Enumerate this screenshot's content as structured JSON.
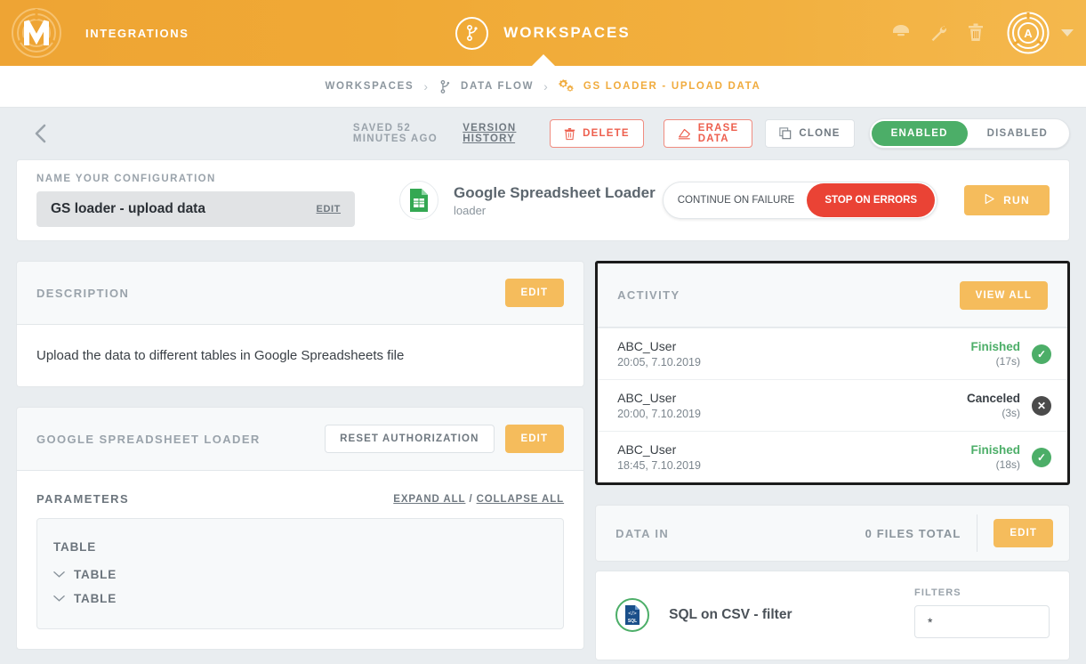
{
  "header": {
    "brand_label": "INTEGRATIONS",
    "center_title": "WORKSPACES",
    "icons": [
      "chat-icon",
      "wrench-icon",
      "trash-icon"
    ],
    "avatar_initial": "A"
  },
  "breadcrumb": {
    "items": [
      {
        "label": "WORKSPACES",
        "icon": null,
        "active": false
      },
      {
        "label": "DATA FLOW",
        "icon": "flow-icon",
        "active": false
      },
      {
        "label": "GS LOADER - UPLOAD DATA",
        "icon": "gears-icon",
        "active": true
      }
    ],
    "separator": "›"
  },
  "actionbar": {
    "back_icon": "chevron-left-icon",
    "saved_text": "SAVED 52 MINUTES AGO",
    "version_history": "VERSION HISTORY",
    "delete_label": "DELETE",
    "erase_label": "ERASE DATA",
    "clone_label": "CLONE",
    "toggle_enabled": "ENABLED",
    "toggle_disabled": "DISABLED",
    "toggle_state": "ENABLED"
  },
  "config": {
    "name_label": "NAME YOUR CONFIGURATION",
    "name_value": "GS loader - upload data",
    "name_edit": "EDIT",
    "component_title": "Google Spreadsheet Loader",
    "component_sub": "loader",
    "component_icon": "google-sheets-icon",
    "failure_continue": "CONTINUE ON FAILURE",
    "failure_stop": "STOP ON ERRORS",
    "failure_state": "STOP ON ERRORS",
    "run_label": "RUN"
  },
  "description": {
    "title": "DESCRIPTION",
    "edit_label": "EDIT",
    "body": "Upload the data to different tables in Google Spreadsheets file"
  },
  "loader_section": {
    "title": "GOOGLE SPREADSHEET LOADER",
    "reset_label": "RESET AUTHORIZATION",
    "edit_label": "EDIT"
  },
  "parameters": {
    "title": "PARAMETERS",
    "expand_all": "EXPAND ALL",
    "collapse_all": "COLLAPSE ALL",
    "slash": "/",
    "root_label": "TABLE",
    "rows": [
      {
        "label": "TABLE",
        "icon": "chevron-down-icon"
      },
      {
        "label": "TABLE",
        "icon": "chevron-down-icon"
      }
    ]
  },
  "activity": {
    "title": "ACTIVITY",
    "view_all": "VIEW ALL",
    "rows": [
      {
        "user": "ABC_User",
        "time": "20:05, 7.10.2019",
        "status": "Finished",
        "duration": "(17s)",
        "state": "ok",
        "badge": "✓"
      },
      {
        "user": "ABC_User",
        "time": "20:00, 7.10.2019",
        "status": "Canceled",
        "duration": "(3s)",
        "state": "no",
        "badge": "✕"
      },
      {
        "user": "ABC_User",
        "time": "18:45, 7.10.2019",
        "status": "Finished",
        "duration": "(18s)",
        "state": "ok",
        "badge": "✓"
      }
    ]
  },
  "data_in": {
    "title": "DATA IN",
    "files_total": "0 FILES TOTAL",
    "edit_label": "EDIT",
    "source_name": "SQL on CSV - filter",
    "source_icon": "sql-file-icon",
    "filters_label": "FILTERS",
    "filters_value": "*"
  },
  "colors": {
    "brand_orange": "#f0a935",
    "accent_amber": "#f5bc5c",
    "danger_red": "#ed5f4e",
    "stop_red": "#ea4335",
    "success_green": "#4cae68",
    "page_bg": "#e9edf0"
  }
}
